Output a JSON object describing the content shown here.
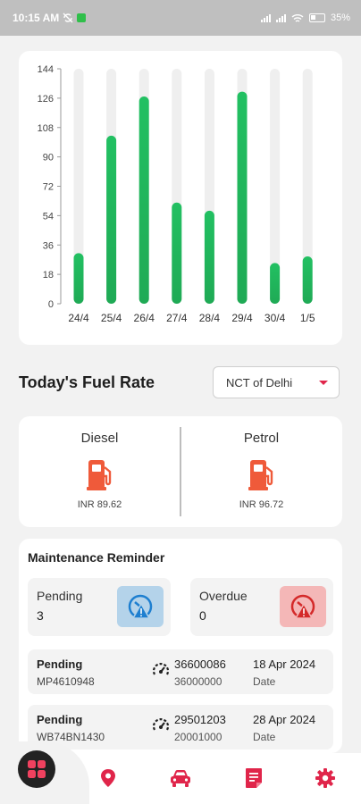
{
  "status_bar": {
    "time": "10:15 AM",
    "battery": "35"
  },
  "chart_data": {
    "type": "bar",
    "categories": [
      "24/4",
      "25/4",
      "26/4",
      "27/4",
      "28/4",
      "29/4",
      "30/4",
      "1/5"
    ],
    "values": [
      31,
      103,
      127,
      62,
      57,
      130,
      25,
      29
    ],
    "yticks": [
      0,
      18,
      36,
      54,
      72,
      90,
      108,
      126,
      144
    ],
    "ylim": [
      0,
      144
    ],
    "title": "",
    "xlabel": "",
    "ylabel": "",
    "colors": {
      "bar": "#1faa55",
      "bar_top": "#22c062",
      "track": "#efefef"
    }
  },
  "fuel_rate": {
    "title": "Today's Fuel Rate",
    "state_selected": "NCT of Delhi",
    "diesel": {
      "label": "Diesel",
      "price": "INR 89.62",
      "icon": "fuel-pump-icon"
    },
    "petrol": {
      "label": "Petrol",
      "price": "INR 96.72",
      "icon": "fuel-pump-icon"
    },
    "accent": "#ef5a3a"
  },
  "maintenance": {
    "title": "Maintenance Reminder",
    "pending": {
      "label": "Pending",
      "count": "3",
      "icon": "gauge-alert-icon"
    },
    "overdue": {
      "label": "Overdue",
      "count": "0",
      "icon": "gauge-alert-icon"
    },
    "rows": [
      {
        "status": "Pending",
        "plate": "MP4610948",
        "odo_current": "36600086",
        "odo_due": "36000000",
        "date": "18 Apr 2024",
        "date_label": "Date"
      },
      {
        "status": "Pending",
        "plate": "WB74BN1430",
        "odo_current": "29501203",
        "odo_due": "20001000",
        "date": "28 Apr 2024",
        "date_label": "Date"
      }
    ]
  },
  "nav": {
    "items": [
      "dashboard-icon",
      "location-pin-icon",
      "car-icon",
      "report-icon",
      "settings-icon"
    ],
    "accent": "#e0254a"
  }
}
